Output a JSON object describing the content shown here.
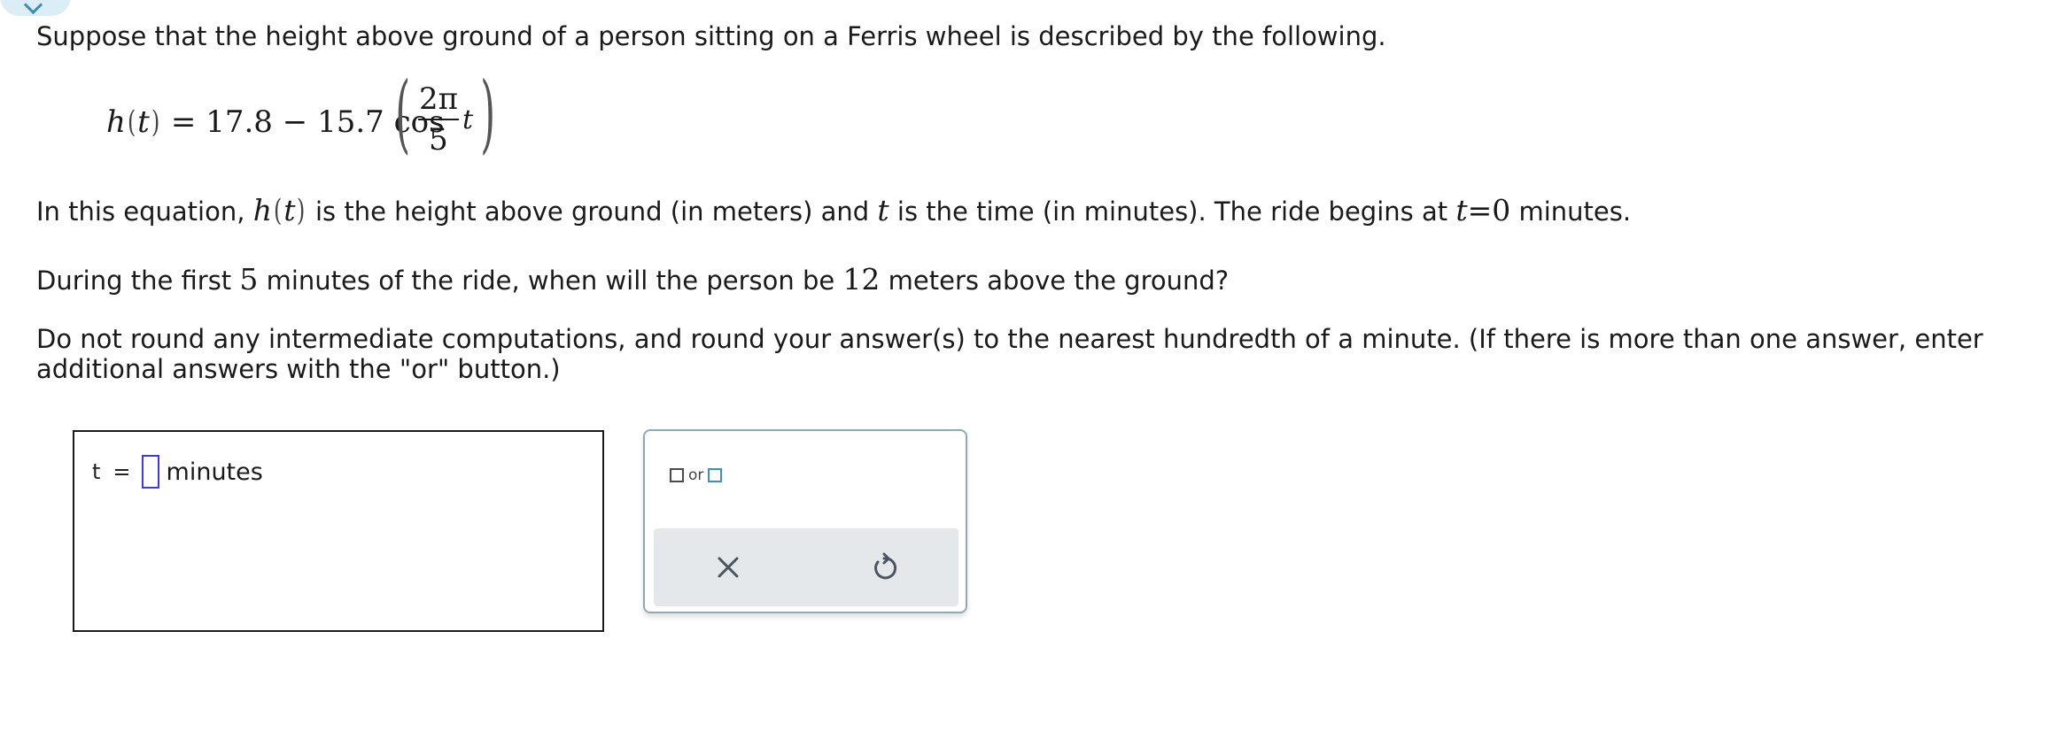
{
  "question": {
    "intro": "Suppose that the height above ground of a person sitting on a Ferris wheel is described by the following.",
    "formula": {
      "lhs_func": "h",
      "lhs_var": "t",
      "equals": "=",
      "constant": "17.8",
      "minus": "−",
      "coefficient": "15.7",
      "trig": "cos",
      "frac_numerator": "2π",
      "frac_denominator": "5",
      "var": "t"
    },
    "definition": {
      "part1": "In this equation, ",
      "func": "h",
      "var": "t",
      "part2": " is the height above ground (in meters) and ",
      "var2": "t",
      "part3": " is the time (in minutes). The ride begins at ",
      "var3": "t",
      "eq": "=",
      "start_value": "0",
      "part4": " minutes."
    },
    "task": {
      "part1": "During the first ",
      "minutes": "5",
      "part2": " minutes of the ride, when will the person be ",
      "height": "12",
      "part3": " meters above the ground?"
    },
    "instructions": "Do not round any intermediate computations, and round your answer(s) to the nearest hundredth of a minute. (If there is more than one answer, enter additional answers with the \"or\" button.)"
  },
  "answer": {
    "var_label": "t",
    "equals": "=",
    "value": "",
    "unit": "minutes"
  },
  "tools": {
    "or_label": "or",
    "clear_icon": "close-icon",
    "undo_icon": "undo-icon"
  },
  "colors": {
    "input_border": "#3b3be0",
    "panel_border": "#8fa9b8",
    "action_bar": "#e4e8eb",
    "or_square_accent": "#3a93b8",
    "corner_tab": "#dbeef5"
  }
}
